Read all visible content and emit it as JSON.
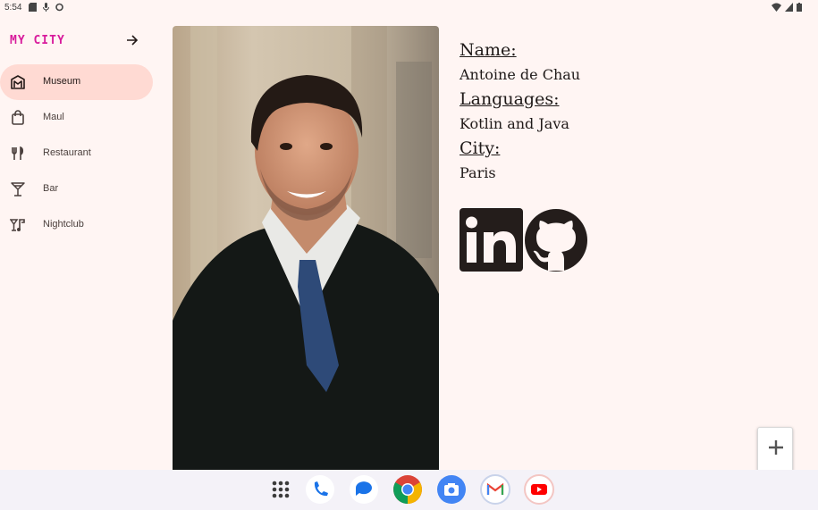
{
  "status_bar": {
    "time": "5:54"
  },
  "app": {
    "title": "MY CITY"
  },
  "drawer": {
    "items": [
      {
        "label": "Museum",
        "icon": "museum-icon",
        "selected": true
      },
      {
        "label": "Maul",
        "icon": "shopping-bag-icon",
        "selected": false
      },
      {
        "label": "Restaurant",
        "icon": "restaurant-icon",
        "selected": false
      },
      {
        "label": "Bar",
        "icon": "cocktail-icon",
        "selected": false
      },
      {
        "label": "Nightclub",
        "icon": "nightlife-icon",
        "selected": false
      }
    ]
  },
  "profile": {
    "name_label": "Name:",
    "name": "Antoine de Chau",
    "languages_label": "Languages:",
    "languages": "Kotlin and Java",
    "city_label": "City:",
    "city": "Paris"
  },
  "social": [
    "linkedin-icon",
    "github-icon"
  ],
  "zoom": {
    "plus": "+",
    "minus": "−"
  },
  "taskbar": {
    "apps": [
      "app-launcher-icon",
      "phone-icon",
      "messages-icon",
      "chrome-icon",
      "camera-icon",
      "gmail-icon",
      "youtube-icon"
    ]
  },
  "colors": {
    "accent": "#d81b9c",
    "selected_bg": "#ffdad3",
    "background": "#fff5f3"
  }
}
